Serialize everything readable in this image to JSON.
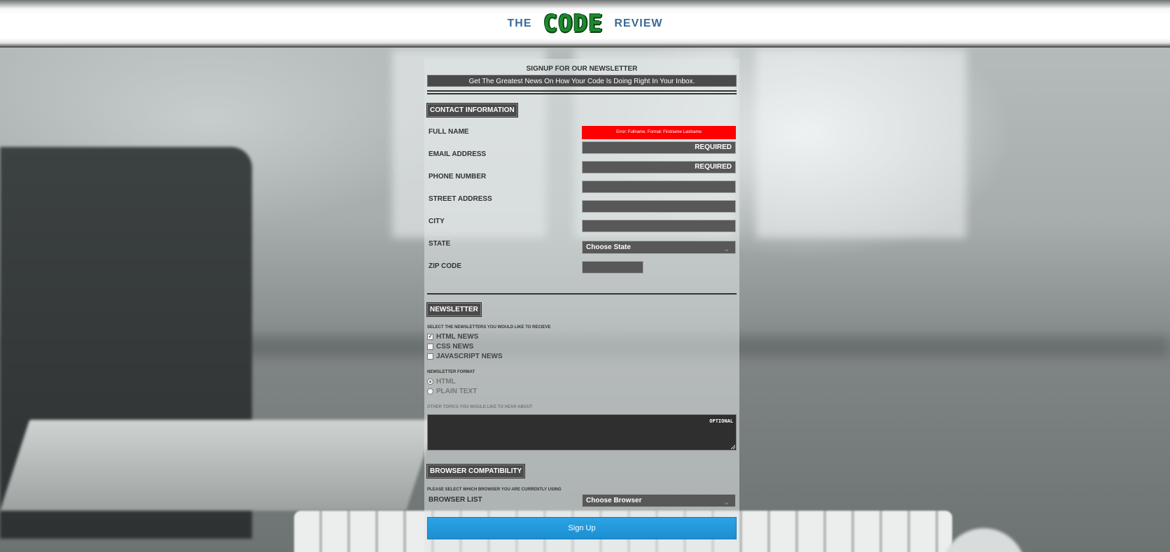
{
  "header": {
    "left_word": "THE",
    "logo_text": "CODE",
    "right_word": "REVIEW"
  },
  "signup": {
    "title": "SIGNUP FOR OUR NEWSLETTER",
    "tagline": "Get The Greatest News On How Your Code Is Doing Right In Your Inbox."
  },
  "contact": {
    "heading": "CONTACT INFORMATION",
    "full_name_label": "FULL NAME",
    "full_name_error": "Error: Fullname. Format: Firstname Lastname",
    "email_label": "EMAIL ADDRESS",
    "email_placeholder": "REQUIRED",
    "phone_label": "PHONE NUMBER",
    "phone_placeholder": "REQUIRED",
    "street_label": "STREET ADDRESS",
    "city_label": "CITY",
    "state_label": "STATE",
    "state_selected": "Choose State",
    "zip_label": "ZIP CODE"
  },
  "newsletter": {
    "heading": "NEWSLETTER",
    "select_prompt": "SELECT THE NEWSLETTERS YOU WOULD LIKE TO RECIEVE",
    "options": [
      {
        "label": "HTML NEWS",
        "checked": true
      },
      {
        "label": "CSS NEWS",
        "checked": false
      },
      {
        "label": "JAVASCRIPT NEWS",
        "checked": false
      }
    ],
    "format_prompt": "NEWSLETTER FORMAT",
    "formats": [
      {
        "label": "HTML",
        "selected": true
      },
      {
        "label": "PLAIN TEXT",
        "selected": false
      }
    ],
    "topics_prompt": "OTHER TOPICS YOU WOULD LIKE TO HEAR ABOUT",
    "topics_placeholder": "OPTIONAL"
  },
  "browser": {
    "heading": "BROWSER COMPATIBILITY",
    "prompt": "PLEASE SELECT WHICH BROWSER YOU ARE CURRENTLY USING",
    "list_label": "BROWSER LIST",
    "selected": "Choose Browser"
  },
  "submit": {
    "label": "Sign Up"
  },
  "colors": {
    "accent_blue": "#1c8fd0",
    "error_red": "#ff0000",
    "brand_blue": "#3a6b98",
    "logo_green": "#1b8a2c"
  }
}
